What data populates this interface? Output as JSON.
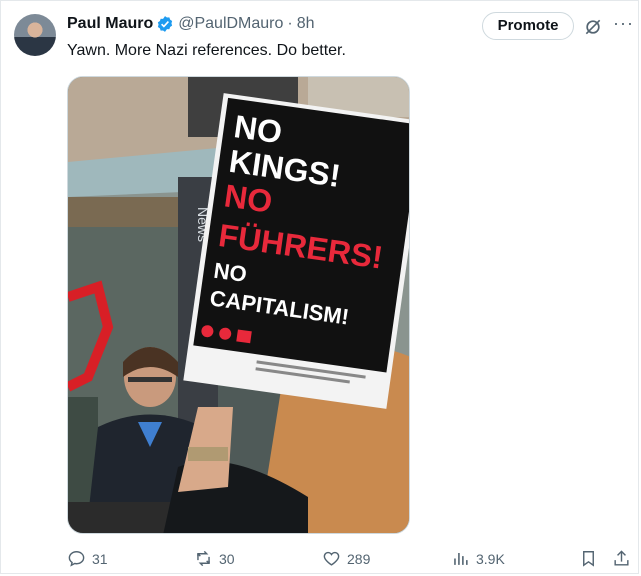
{
  "tweet": {
    "author_name": "Paul Mauro",
    "handle": "@PaulDMauro",
    "separator": "·",
    "time": "8h",
    "text": "Yawn. More Nazi references. Do better.",
    "promote_label": "Promote"
  },
  "sign": {
    "line1": "NO",
    "line2": "KINGS!",
    "line3": "NO",
    "line4": "FÜHRERS!",
    "line5": "NO",
    "line6": "CAPITALISM!"
  },
  "actions": {
    "replies": "31",
    "reposts": "30",
    "likes": "289",
    "views": "3.9K"
  },
  "colors": {
    "verified": "#1d9bf0",
    "muted": "#536471",
    "sign_red": "#e8293b",
    "sign_black": "#111111"
  },
  "icons": [
    "verified-badge-icon",
    "grok-icon",
    "more-icon",
    "reply-icon",
    "repost-icon",
    "like-icon",
    "views-icon",
    "bookmark-icon",
    "share-icon"
  ]
}
